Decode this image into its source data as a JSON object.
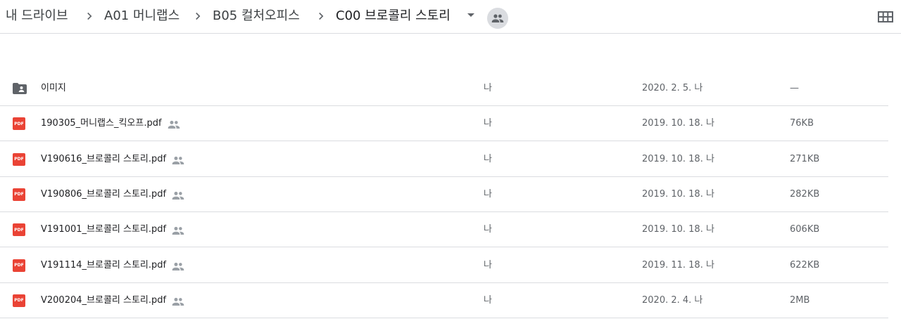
{
  "breadcrumb": [
    {
      "label": "내 드라이브"
    },
    {
      "label": "A01 머니랩스"
    },
    {
      "label": "B05 컬처오피스"
    },
    {
      "label": "C00 브로콜리 스토리"
    }
  ],
  "icons": {
    "separator": "chevron-right-icon",
    "dropdown": "arrow-drop-down-icon",
    "shared": "people-icon",
    "view_toggle": "grid-view-icon",
    "folder": "shared-folder-icon",
    "pdf": "pdf-file-icon"
  },
  "pdf_badge": "PDF",
  "colors": {
    "pdf": "#ea4335",
    "folder": "#5f6368",
    "divider": "#dadce0",
    "secondary_text": "#5f6368"
  },
  "files": [
    {
      "name": "이미지",
      "type": "folder",
      "shared": false,
      "owner": "나",
      "modified": "2020. 2. 5. 나",
      "size": "—"
    },
    {
      "name": "190305_머니랩스_킥오프.pdf",
      "type": "pdf",
      "shared": true,
      "owner": "나",
      "modified": "2019. 10. 18. 나",
      "size": "76KB"
    },
    {
      "name": "V190616_브로콜리 스토리.pdf",
      "type": "pdf",
      "shared": true,
      "owner": "나",
      "modified": "2019. 10. 18. 나",
      "size": "271KB"
    },
    {
      "name": "V190806_브로콜리 스토리.pdf",
      "type": "pdf",
      "shared": true,
      "owner": "나",
      "modified": "2019. 10. 18. 나",
      "size": "282KB"
    },
    {
      "name": "V191001_브로콜리 스토리.pdf",
      "type": "pdf",
      "shared": true,
      "owner": "나",
      "modified": "2019. 10. 18. 나",
      "size": "606KB"
    },
    {
      "name": "V191114_브로콜리 스토리.pdf",
      "type": "pdf",
      "shared": true,
      "owner": "나",
      "modified": "2019. 11. 18. 나",
      "size": "622KB"
    },
    {
      "name": "V200204_브로콜리 스토리.pdf",
      "type": "pdf",
      "shared": true,
      "owner": "나",
      "modified": "2020. 2. 4. 나",
      "size": "2MB"
    }
  ]
}
